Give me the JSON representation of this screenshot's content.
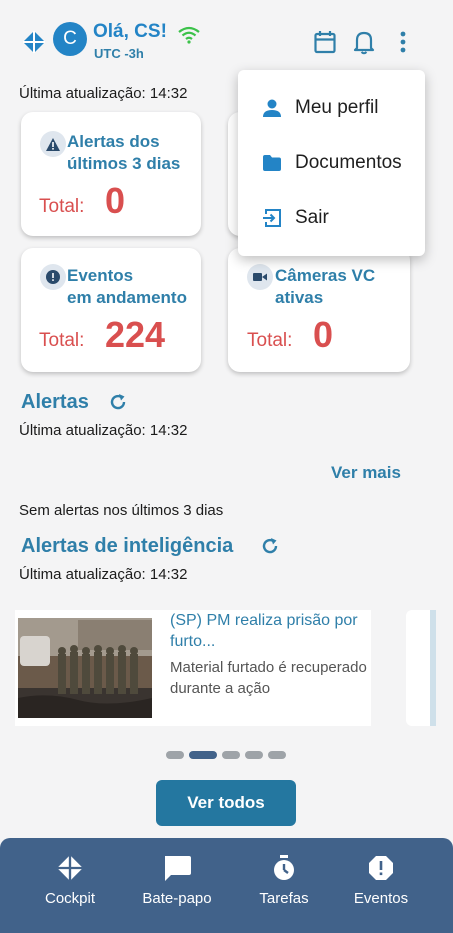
{
  "header": {
    "avatar_letter": "C",
    "greeting": "Olá, CS!",
    "timezone": "UTC -3h",
    "icons": [
      "app-logo-icon",
      "wifi-icon",
      "calendar-icon",
      "bell-icon",
      "more-vert-icon"
    ]
  },
  "summary": {
    "last_update": "Última atualização: 14:32",
    "cards": [
      {
        "title_line1": "Alertas dos",
        "title_line2": "últimos 3 dias",
        "total_label": "Total:",
        "value": "0",
        "icon": "warning-icon"
      },
      {
        "title_line1": "Eventos",
        "title_line2": "em andamento",
        "total_label": "Total:",
        "value": "224",
        "icon": "alert-circle-icon"
      },
      {
        "title_line1": "Câmeras VC",
        "title_line2": "ativas",
        "total_label": "Total:",
        "value": "0",
        "icon": "videocam-icon"
      }
    ]
  },
  "alerts": {
    "title": "Alertas",
    "last_update": "Última atualização: 14:32",
    "see_more": "Ver mais",
    "empty_message": "Sem alertas nos últimos 3 dias"
  },
  "intel": {
    "title": "Alertas de inteligência",
    "last_update": "Última atualização: 14:32",
    "news": {
      "title": "(SP) PM realiza prisão por furto...",
      "description": "Material furtado é recuperado durante a ação"
    },
    "carousel_pages": 5,
    "active_page": 2,
    "see_all": "Ver todos"
  },
  "menu": {
    "items": [
      {
        "label": "Meu perfil",
        "icon": "person-icon"
      },
      {
        "label": "Documentos",
        "icon": "folder-icon"
      },
      {
        "label": "Sair",
        "icon": "logout-icon"
      }
    ]
  },
  "bottom_nav": {
    "items": [
      {
        "label": "Cockpit",
        "icon": "cockpit-icon"
      },
      {
        "label": "Bate-papo",
        "icon": "chat-icon"
      },
      {
        "label": "Tarefas",
        "icon": "stopwatch-icon"
      },
      {
        "label": "Eventos",
        "icon": "event-alert-icon"
      }
    ]
  },
  "colors": {
    "primary": "#2f7fa9",
    "avatar": "#2384c6",
    "danger": "#d94f4f",
    "nav_bg": "#41628a",
    "button": "#2477a0",
    "wifi": "#3cc24a"
  }
}
